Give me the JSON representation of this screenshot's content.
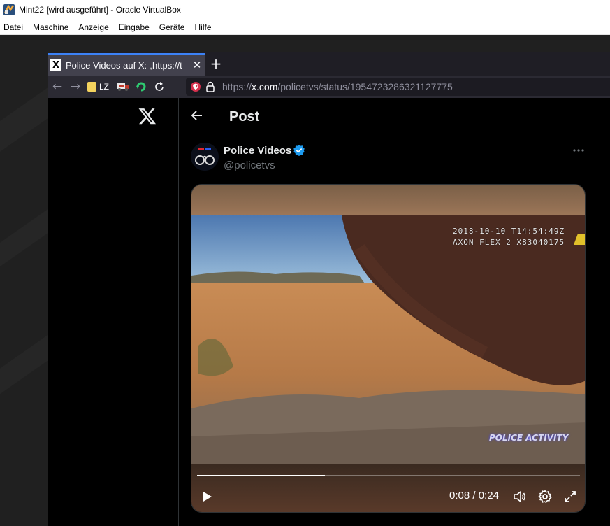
{
  "vbox": {
    "title": "Mint22 [wird ausgeführt] - Oracle VirtualBox",
    "menu": [
      "Datei",
      "Maschine",
      "Anzeige",
      "Eingabe",
      "Geräte",
      "Hilfe"
    ]
  },
  "browser": {
    "tab": {
      "title": "Police Videos auf X: „https://t",
      "favicon": "X"
    },
    "bookmark_label": "LZ",
    "url": {
      "scheme": "https://",
      "host": "x.com",
      "path": "/policetvs/status/1954723286321127775"
    }
  },
  "post": {
    "header_title": "Post",
    "author_name": "Police Videos",
    "author_handle": "@policetvs",
    "video": {
      "timestamp_line1": "2018-10-10 T14:54:49Z",
      "timestamp_line2": "AXON FLEX 2 X83040175",
      "watermark": "POLICE ACTIVITY",
      "current_time": "0:08",
      "duration": "0:24",
      "time_separator": " / ",
      "progress_fraction": 0.3333
    }
  },
  "colors": {
    "tab_accent": "#3c82f6",
    "verified_badge": "#1d9bf0",
    "x_text": "#e7e9ea",
    "x_secondary": "#71767b"
  }
}
